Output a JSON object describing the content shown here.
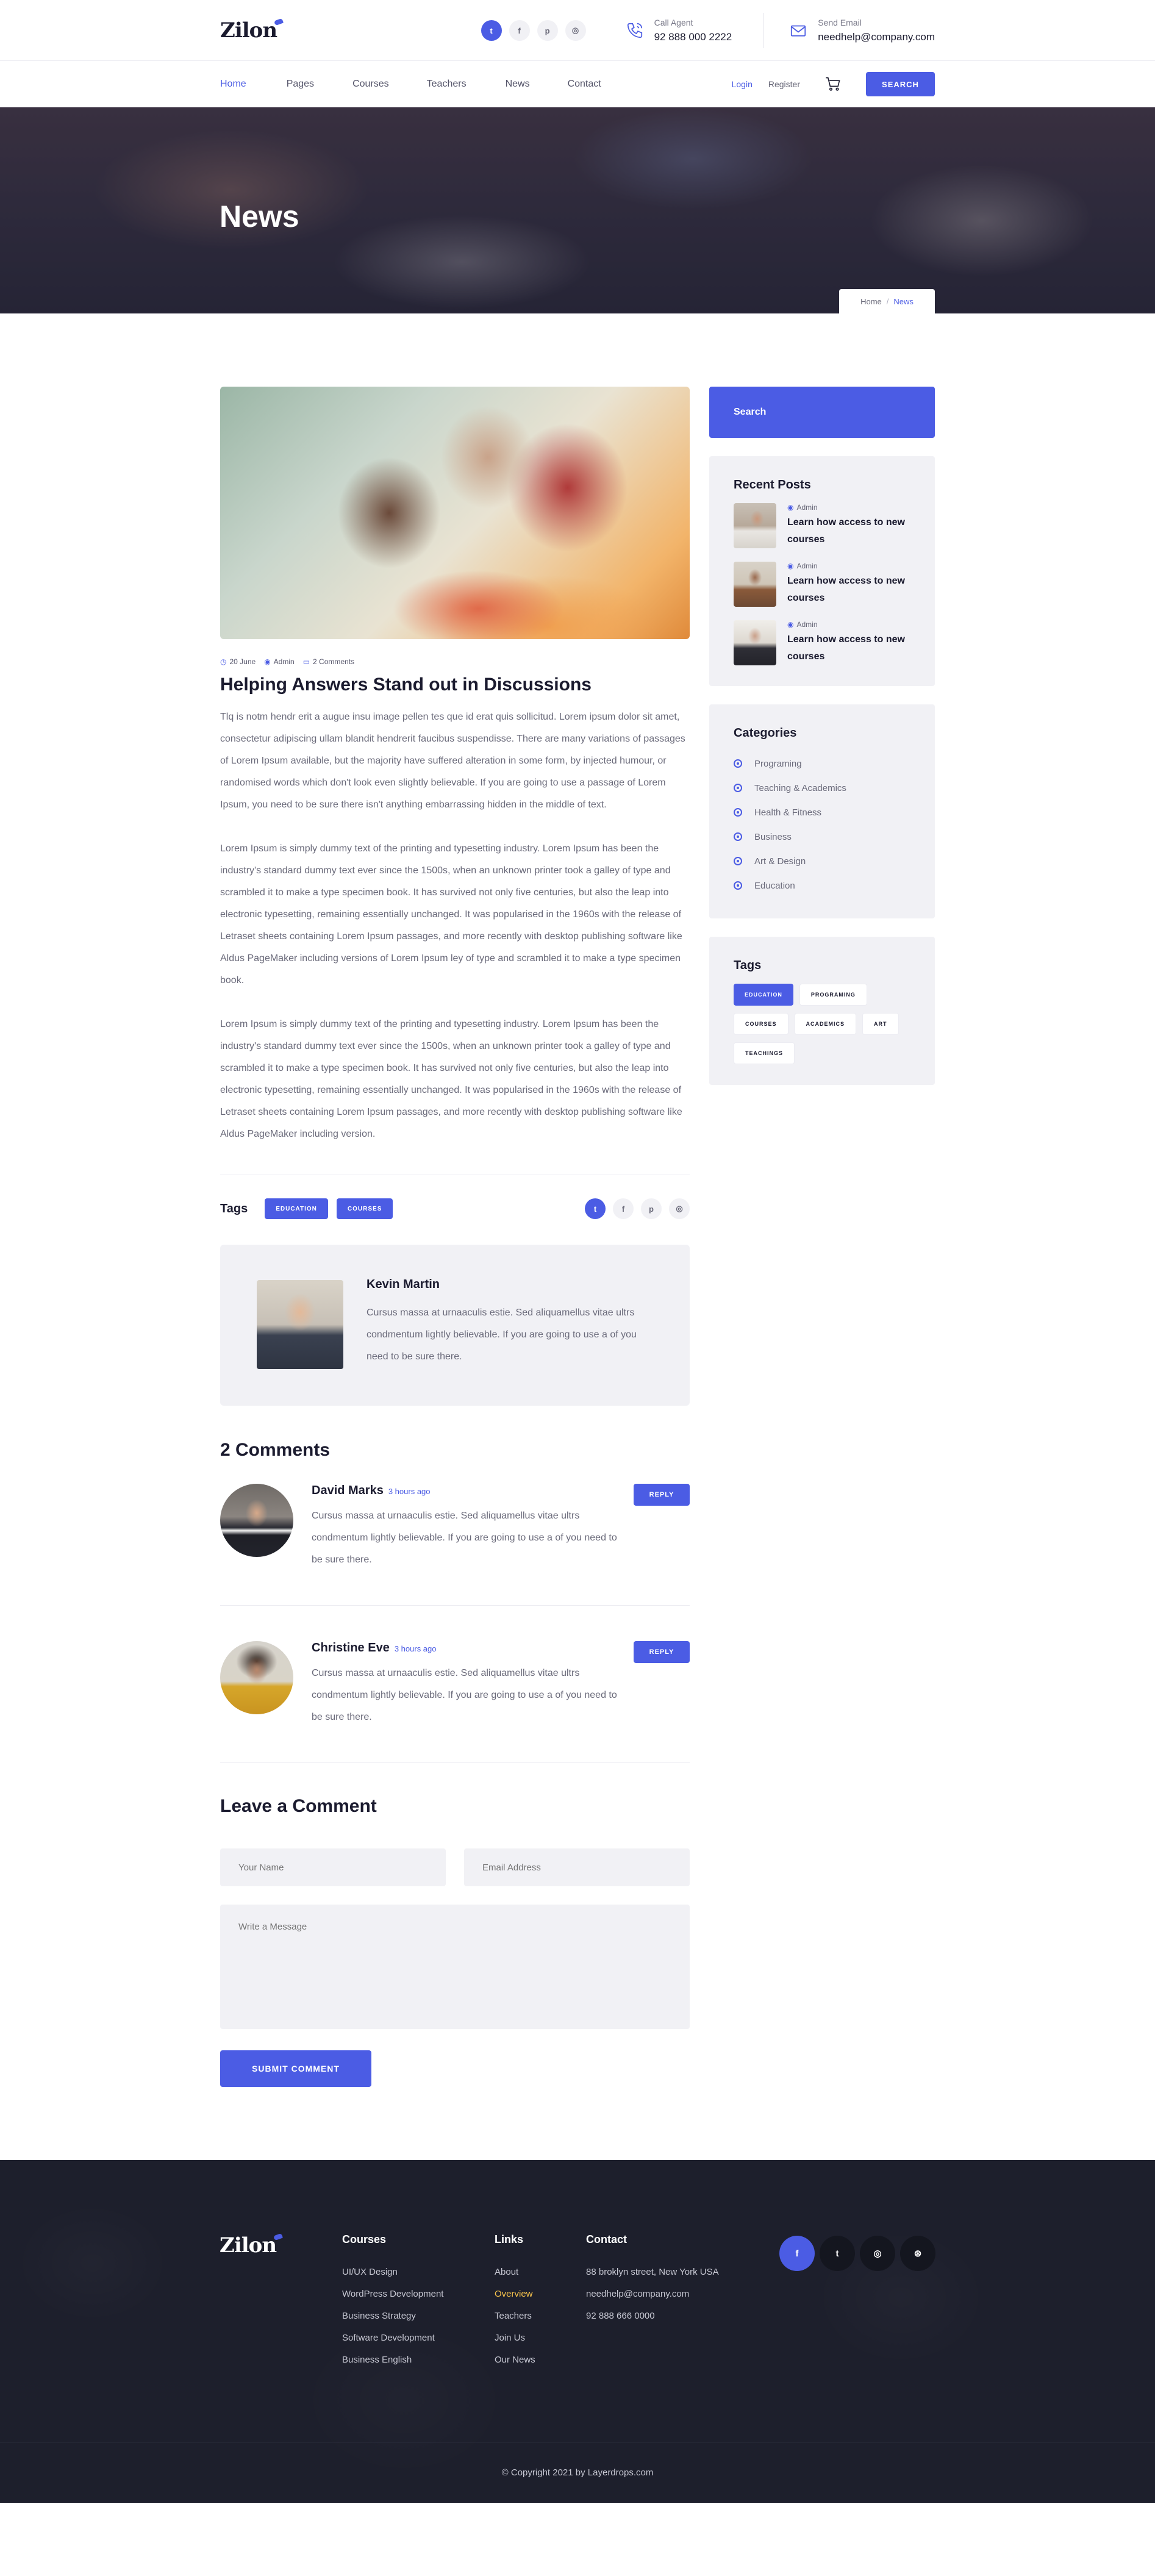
{
  "brand": {
    "logo_text": "Zilon"
  },
  "topbar": {
    "socials": [
      {
        "icon": "twitter-icon",
        "glyph": "t"
      },
      {
        "icon": "facebook-icon",
        "glyph": "f"
      },
      {
        "icon": "pinterest-icon",
        "glyph": "p"
      },
      {
        "icon": "instagram-icon",
        "glyph": "◎"
      }
    ],
    "call_label": "Call Agent",
    "call_value": "92 888 000 2222",
    "email_label": "Send Email",
    "email_value": "needhelp@company.com"
  },
  "nav": {
    "items": [
      "Home",
      "Pages",
      "Courses",
      "Teachers",
      "News",
      "Contact"
    ],
    "active": "Home",
    "login": "Login",
    "register": "Register",
    "search_button": "SEARCH"
  },
  "hero": {
    "title": "News",
    "breadcrumb": {
      "home": "Home",
      "separator": "/",
      "current": "News"
    }
  },
  "article": {
    "meta": {
      "date": "20 June",
      "author": "Admin",
      "comments": "2 Comments"
    },
    "title": "Helping Answers Stand out in Discussions",
    "paragraphs": [
      "Tlq is notm hendr erit a augue insu image pellen tes que id erat quis sollicitud. Lorem ipsum dolor sit amet, consectetur adipiscing ullam blandit hendrerit faucibus suspendisse. There are many variations of passages of Lorem Ipsum available, but the majority have suffered alteration in some form, by injected humour, or randomised words which don't look even slightly believable. If you are going to use a passage of Lorem Ipsum, you need to be sure there isn't anything embarrassing hidden in the middle of text.",
      "Lorem Ipsum is simply dummy text of the printing and typesetting industry. Lorem Ipsum has been the industry's standard dummy text ever since the 1500s, when an unknown printer took a galley of type and scrambled it to make a type specimen book. It has survived not only five centuries, but also the leap into electronic typesetting, remaining essentially unchanged. It was popularised in the 1960s with the release of Letraset sheets containing Lorem Ipsum passages, and more recently with desktop publishing software like Aldus PageMaker including versions of Lorem Ipsum ley of type and scrambled it to make a type specimen book.",
      "Lorem Ipsum is simply dummy text of the printing and typesetting industry. Lorem Ipsum has been the industry's standard dummy text ever since the 1500s, when an unknown printer took a galley of type and scrambled it to make a type specimen book. It has survived not only five centuries, but also the leap into electronic typesetting, remaining essentially unchanged. It was popularised in the 1960s with the release of Letraset sheets containing Lorem Ipsum passages, and more recently with desktop publishing software like Aldus PageMaker including version."
    ],
    "tags_title": "Tags",
    "tags": [
      "EDUCATION",
      "COURSES"
    ]
  },
  "author": {
    "name": "Kevin Martin",
    "bio": "Cursus massa at urnaaculis estie. Sed aliquamellus vitae ultrs condmentum lightly believable. If you are going to use a of you need to be sure there."
  },
  "comments": {
    "title": "2 Comments",
    "items": [
      {
        "name": "David Marks",
        "time": "3 hours ago",
        "text": "Cursus massa at urnaaculis estie. Sed aliquamellus vitae ultrs condmentum lightly believable. If you are going to use a of you need to be sure there.",
        "reply": "REPLY"
      },
      {
        "name": "Christine Eve",
        "time": "3 hours ago",
        "text": "Cursus massa at urnaaculis estie. Sed aliquamellus vitae ultrs condmentum lightly believable. If you are going to use a of you need to be sure there.",
        "reply": "REPLY"
      }
    ]
  },
  "comment_form": {
    "title": "Leave a Comment",
    "name_placeholder": "Your Name",
    "email_placeholder": "Email Address",
    "message_placeholder": "Write a Message",
    "submit": "SUBMIT COMMENT"
  },
  "sidebar": {
    "search_placeholder": "Search",
    "recent_title": "Recent Posts",
    "recent": [
      {
        "by": "Admin",
        "title": "Learn how access to new courses"
      },
      {
        "by": "Admin",
        "title": "Learn how access to new courses"
      },
      {
        "by": "Admin",
        "title": "Learn how access to new courses"
      }
    ],
    "categories_title": "Categories",
    "categories": [
      "Programing",
      "Teaching & Academics",
      "Health & Fitness",
      "Business",
      "Art & Design",
      "Education"
    ],
    "tags_title": "Tags",
    "tags": [
      "EDUCATION",
      "PROGRAMING",
      "COURSES",
      "ACADEMICS",
      "ART",
      "TEACHINGS"
    ],
    "active_tag": "EDUCATION"
  },
  "footer": {
    "courses_title": "Courses",
    "courses": [
      "UI/UX Design",
      "WordPress Development",
      "Business Strategy",
      "Software Development",
      "Business English"
    ],
    "links_title": "Links",
    "links": [
      "About",
      "Overview",
      "Teachers",
      "Join Us",
      "Our News"
    ],
    "highlight_link": "Overview",
    "contact_title": "Contact",
    "contact": [
      "88 broklyn street, New York USA",
      "needhelp@company.com",
      "92 888 666 0000"
    ],
    "socials": [
      {
        "icon": "facebook-icon",
        "glyph": "f"
      },
      {
        "icon": "twitter-icon",
        "glyph": "t"
      },
      {
        "icon": "instagram-icon",
        "glyph": "◎"
      },
      {
        "icon": "dribbble-icon",
        "glyph": "⊛"
      }
    ],
    "copyright": "© Copyright 2021 by Layerdrops.com"
  },
  "colors": {
    "accent": "#4b5ce4",
    "dark": "#1d1f2c",
    "highlight": "#f5c24c"
  }
}
